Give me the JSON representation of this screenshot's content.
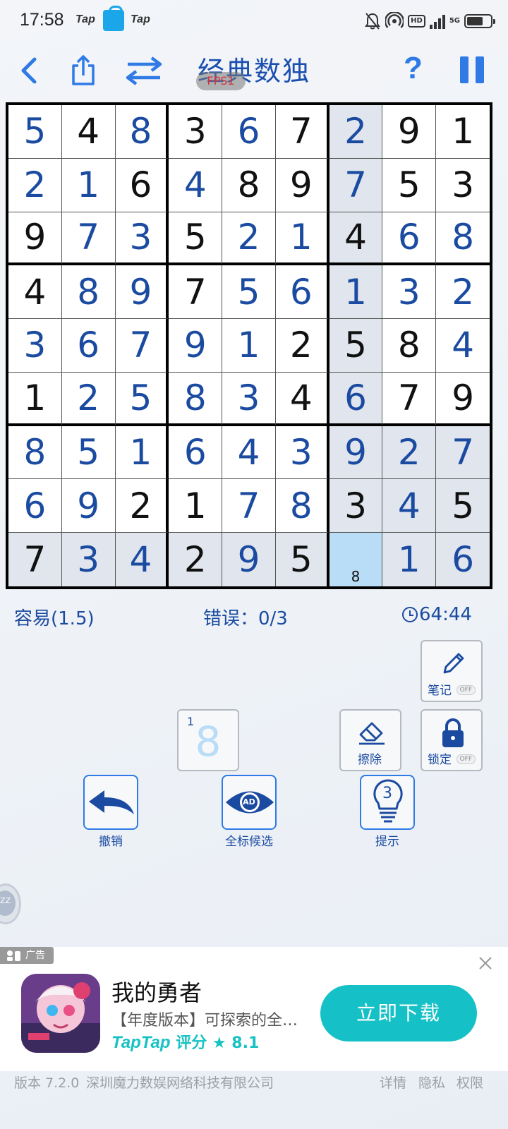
{
  "status_bar": {
    "time": "17:58",
    "notif_app_1": "Tap",
    "notif_app_2": "Tap",
    "icons": [
      "bell-off-icon",
      "hotspot-icon",
      "hd-icon",
      "signal-icon",
      "battery-icon"
    ],
    "hd": "HD",
    "network": "5G",
    "battery_level": 0.7
  },
  "header": {
    "title": "经典数独",
    "fps_badge": "FPS1",
    "help_label": "?"
  },
  "board": {
    "grid": [
      [
        5,
        4,
        8,
        3,
        6,
        7,
        2,
        9,
        1
      ],
      [
        2,
        1,
        6,
        4,
        8,
        9,
        7,
        5,
        3
      ],
      [
        9,
        7,
        3,
        5,
        2,
        1,
        4,
        6,
        8
      ],
      [
        4,
        8,
        9,
        7,
        5,
        6,
        1,
        3,
        2
      ],
      [
        3,
        6,
        7,
        9,
        1,
        2,
        5,
        8,
        4
      ],
      [
        1,
        2,
        5,
        8,
        3,
        4,
        6,
        7,
        9
      ],
      [
        8,
        5,
        1,
        6,
        4,
        3,
        9,
        2,
        7
      ],
      [
        6,
        9,
        2,
        1,
        7,
        8,
        3,
        4,
        5
      ],
      [
        7,
        3,
        4,
        2,
        9,
        5,
        0,
        1,
        6
      ]
    ],
    "entered": [
      [
        1,
        0,
        1,
        0,
        1,
        0,
        1,
        0,
        0
      ],
      [
        1,
        1,
        0,
        1,
        0,
        0,
        1,
        0,
        0
      ],
      [
        0,
        1,
        1,
        0,
        1,
        1,
        0,
        1,
        1
      ],
      [
        0,
        1,
        1,
        0,
        1,
        1,
        1,
        1,
        1
      ],
      [
        1,
        1,
        1,
        1,
        1,
        0,
        0,
        0,
        1
      ],
      [
        0,
        1,
        1,
        1,
        1,
        0,
        1,
        0,
        0
      ],
      [
        1,
        1,
        1,
        1,
        1,
        1,
        1,
        1,
        1
      ],
      [
        1,
        1,
        0,
        0,
        1,
        1,
        0,
        1,
        0
      ],
      [
        0,
        1,
        1,
        0,
        1,
        0,
        0,
        1,
        1
      ]
    ],
    "selected": [
      8,
      6
    ],
    "selected_note": "8"
  },
  "info": {
    "difficulty": "容易(1.5)",
    "errors": "错误：0/3",
    "timer": "64:44"
  },
  "tools": {
    "notes_label": "笔记",
    "notes_state": "OFF",
    "erase_label": "擦除",
    "lock_label": "锁定",
    "lock_state": "OFF",
    "number_small": "1",
    "number_big": "8"
  },
  "actions": {
    "undo_label": "撤销",
    "mark_all_label": "全标候选",
    "mark_all_badge": "AD",
    "hint_label": "提示",
    "hint_count": "3"
  },
  "floating": {
    "label": "ZZ"
  },
  "ad": {
    "tag": "广告",
    "title": "我的勇者",
    "desc": "【年度版本】可探索的全…",
    "brand": "TapTap",
    "rating_label": "评分",
    "rating": "★ 8.1",
    "button": "立即下载"
  },
  "footer": {
    "version": "版本 7.2.0",
    "company": "深圳魔力数娱网络科技有限公司",
    "details": "详情",
    "privacy": "隐私",
    "permissions": "权限"
  },
  "colors": {
    "accent": "#2f7ae5",
    "entered_digit": "#1b4ba0",
    "highlight": "#e0e5ee",
    "selected": "#b9dcf7",
    "ad_button": "#15c1c6"
  }
}
